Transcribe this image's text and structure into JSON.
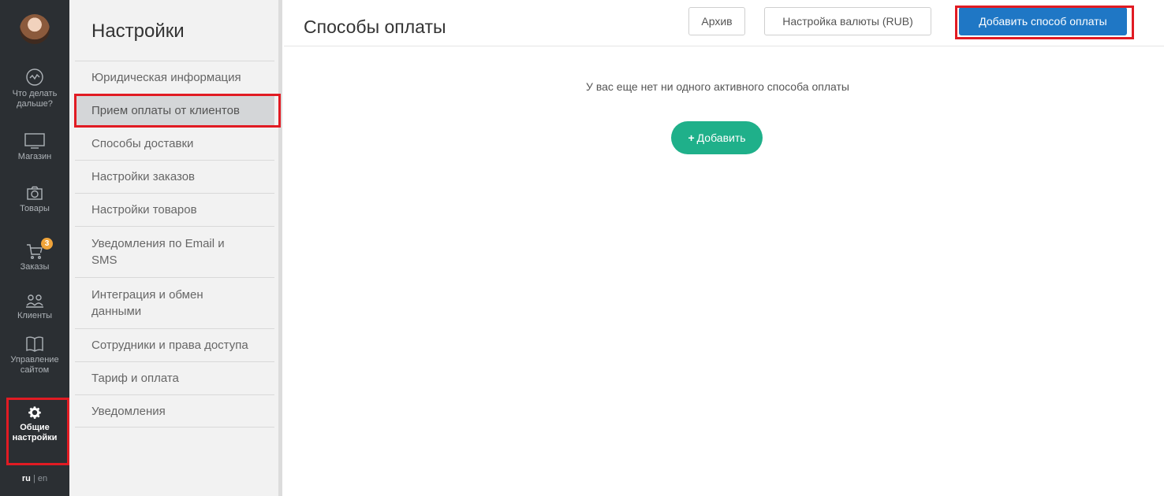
{
  "rail": {
    "items": [
      {
        "label": "Что делать дальше?",
        "icon": "compass-icon"
      },
      {
        "label": "Магазин",
        "icon": "monitor-icon"
      },
      {
        "label": "Товары",
        "icon": "camera-icon"
      },
      {
        "label": "Заказы",
        "icon": "cart-icon",
        "badge": "3"
      },
      {
        "label": "Клиенты",
        "icon": "users-icon"
      },
      {
        "label": "Управление сайтом",
        "icon": "book-icon"
      },
      {
        "label": "Общие настройки",
        "icon": "gear-icon",
        "active": true
      }
    ],
    "lang_active": "ru",
    "lang_sep": "|",
    "lang_other": "en"
  },
  "sidebar": {
    "title": "Настройки",
    "items": [
      {
        "label": "Юридическая информация"
      },
      {
        "label": "Прием оплаты от клиентов",
        "active": true
      },
      {
        "label": "Способы доставки"
      },
      {
        "label": "Настройки заказов"
      },
      {
        "label": "Настройки товаров"
      },
      {
        "label": "Уведомления по Email и SMS"
      },
      {
        "label": "Интеграция и обмен данными"
      },
      {
        "label": "Сотрудники и права доступа"
      },
      {
        "label": "Тариф и оплата"
      },
      {
        "label": "Уведомления"
      }
    ]
  },
  "main": {
    "title": "Способы оплаты",
    "archive_label": "Архив",
    "currency_label": "Настройка валюты (RUB)",
    "add_method_label": "Добавить способ оплаты",
    "empty_text": "У вас еще нет ни одного активного способа оплаты",
    "add_label": "Добавить",
    "add_plus": "+"
  },
  "colors": {
    "rail_bg": "#2b2f33",
    "primary": "#1f77c5",
    "add_green": "#1fb08a",
    "highlight_red": "#e11b23",
    "badge_orange": "#f0a43a"
  }
}
